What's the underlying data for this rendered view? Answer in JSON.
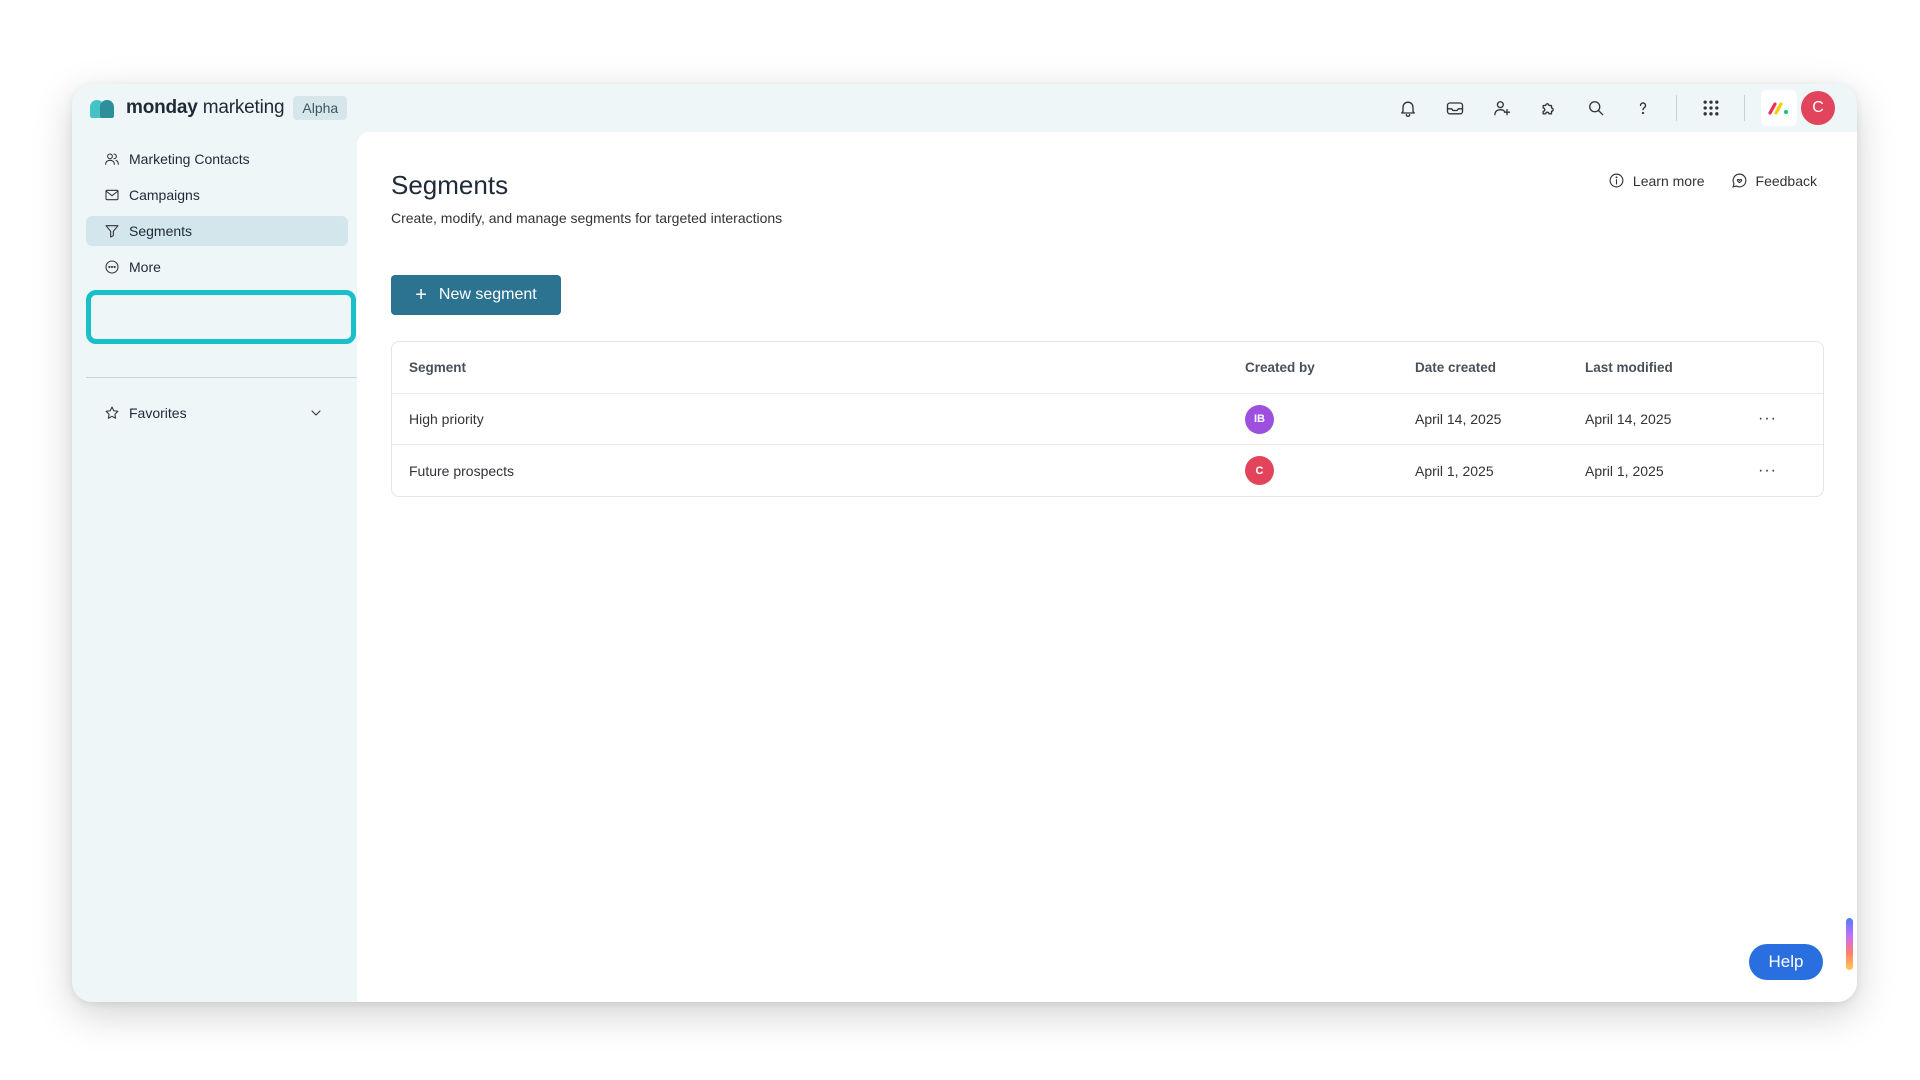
{
  "app": {
    "brand_bold": "monday",
    "brand_light": "marketing",
    "badge": "Alpha",
    "user_initial": "C"
  },
  "topbar_icons": [
    "bell-icon",
    "inbox-icon",
    "invite-user-icon",
    "apps-puzzle-icon",
    "search-icon",
    "help-question-icon",
    "grid-menu-icon"
  ],
  "sidebar": {
    "items": [
      {
        "label": "Marketing Contacts",
        "icon": "contacts-icon"
      },
      {
        "label": "Campaigns",
        "icon": "mail-icon"
      },
      {
        "label": "Segments",
        "icon": "filter-icon",
        "active": true
      },
      {
        "label": "More",
        "icon": "more-circle-icon"
      }
    ],
    "favorites": "Favorites"
  },
  "main": {
    "title": "Segments",
    "subtitle": "Create, modify, and manage segments for targeted interactions",
    "learn_more": "Learn more",
    "feedback": "Feedback",
    "new_button": "New segment",
    "table": {
      "headers": [
        "Segment",
        "Created by",
        "Date created",
        "Last modified"
      ],
      "rows": [
        {
          "segment": "High priority",
          "created_by": "IB",
          "avatar_color": "#9d50dd",
          "date_created": "April 14, 2025",
          "last_modified": "April 14, 2025"
        },
        {
          "segment": "Future prospects",
          "created_by": "C",
          "avatar_color": "#e2445c",
          "date_created": "April 1, 2025",
          "last_modified": "April 1, 2025"
        }
      ]
    },
    "help": "Help"
  },
  "colors": {
    "accent": "#2c7391",
    "highlight": "#19c0c9",
    "help": "#2a6fe0"
  }
}
